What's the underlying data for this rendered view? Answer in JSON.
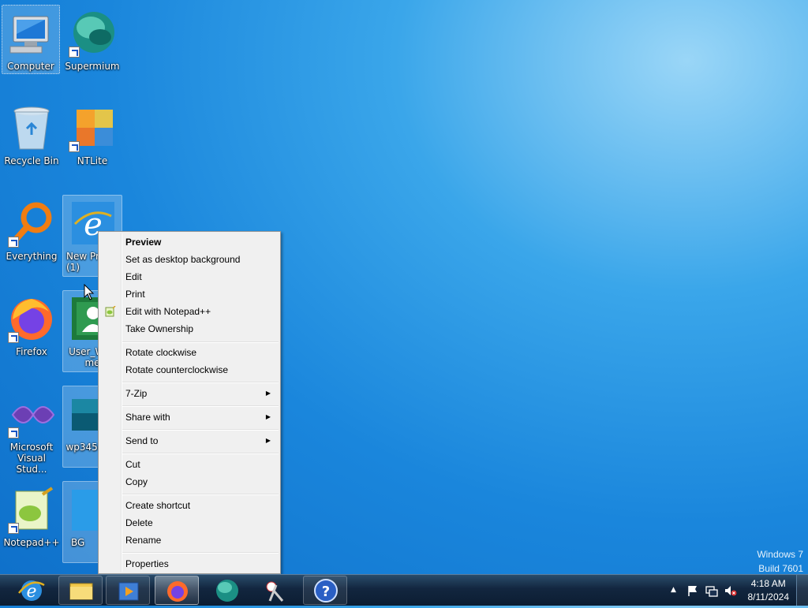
{
  "desktop": {
    "icons": [
      {
        "label": "Computer"
      },
      {
        "label": "Supermium"
      },
      {
        "label": "Recycle Bin"
      },
      {
        "label": "NTLite"
      },
      {
        "label": "Everything"
      },
      {
        "label": "New Pr... (1)"
      },
      {
        "label": "Firefox"
      },
      {
        "label": "User_Wi... me"
      },
      {
        "label": "Microsoft Visual Stud..."
      },
      {
        "label": "wp34562..."
      },
      {
        "label": "Notepad++"
      },
      {
        "label": "BG"
      }
    ]
  },
  "context_menu": {
    "items": [
      {
        "label": "Preview"
      },
      {
        "label": "Set as desktop background"
      },
      {
        "label": "Edit"
      },
      {
        "label": "Print"
      },
      {
        "label": "Edit with Notepad++"
      },
      {
        "label": "Take Ownership"
      },
      {
        "label": "Rotate clockwise"
      },
      {
        "label": "Rotate counterclockwise"
      },
      {
        "label": "7-Zip"
      },
      {
        "label": "Share with"
      },
      {
        "label": "Send to"
      },
      {
        "label": "Cut"
      },
      {
        "label": "Copy"
      },
      {
        "label": "Create shortcut"
      },
      {
        "label": "Delete"
      },
      {
        "label": "Rename"
      },
      {
        "label": "Properties"
      }
    ]
  },
  "watermark": {
    "line1": "Windows 7",
    "line2": "Build 7601"
  },
  "taskbar": {
    "pinned": [
      "internet-explorer-icon",
      "file-explorer-icon",
      "media-player-icon",
      "firefox-icon",
      "supermium-icon",
      "snipping-tool-icon",
      "help-icon"
    ],
    "clock": {
      "time": "4:18 AM",
      "date": "8/11/2024"
    }
  }
}
